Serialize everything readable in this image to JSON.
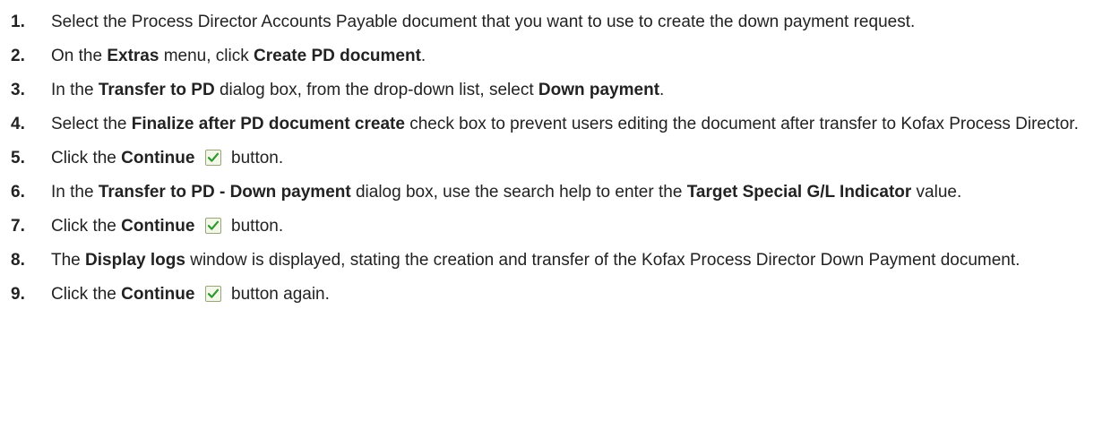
{
  "steps": [
    {
      "num": "1.",
      "segments": [
        {
          "text": "Select the Process Director Accounts Payable document that you want to use to create the down payment request.",
          "bold": false
        }
      ]
    },
    {
      "num": "2.",
      "segments": [
        {
          "text": "On the ",
          "bold": false
        },
        {
          "text": "Extras",
          "bold": true
        },
        {
          "text": " menu, click ",
          "bold": false
        },
        {
          "text": "Create PD document",
          "bold": true
        },
        {
          "text": ".",
          "bold": false
        }
      ]
    },
    {
      "num": "3.",
      "segments": [
        {
          "text": "In the ",
          "bold": false
        },
        {
          "text": "Transfer to PD",
          "bold": true
        },
        {
          "text": " dialog box, from the drop-down list, select ",
          "bold": false
        },
        {
          "text": "Down payment",
          "bold": true
        },
        {
          "text": ".",
          "bold": false
        }
      ]
    },
    {
      "num": "4.",
      "segments": [
        {
          "text": "Select the ",
          "bold": false
        },
        {
          "text": "Finalize after PD document create",
          "bold": true
        },
        {
          "text": " check box to prevent users editing the document after transfer to Kofax Process Director.",
          "bold": false
        }
      ]
    },
    {
      "num": "5.",
      "segments": [
        {
          "text": "Click the ",
          "bold": false
        },
        {
          "text": "Continue",
          "bold": true
        },
        {
          "icon": "checkmark-icon"
        },
        {
          "text": "button.",
          "bold": false
        }
      ]
    },
    {
      "num": "6.",
      "segments": [
        {
          "text": "In the ",
          "bold": false
        },
        {
          "text": "Transfer to PD - Down payment",
          "bold": true
        },
        {
          "text": " dialog box, use the search help to enter the ",
          "bold": false
        },
        {
          "text": "Target Special G/L Indicator",
          "bold": true
        },
        {
          "text": " value.",
          "bold": false
        }
      ]
    },
    {
      "num": "7.",
      "segments": [
        {
          "text": "Click the ",
          "bold": false
        },
        {
          "text": "Continue",
          "bold": true
        },
        {
          "icon": "checkmark-icon"
        },
        {
          "text": "button.",
          "bold": false
        }
      ]
    },
    {
      "num": "8.",
      "segments": [
        {
          "text": "The ",
          "bold": false
        },
        {
          "text": "Display logs",
          "bold": true
        },
        {
          "text": " window is displayed, stating the creation and transfer of the Kofax Process Director Down Payment document.",
          "bold": false
        }
      ]
    },
    {
      "num": "9.",
      "segments": [
        {
          "text": "Click the ",
          "bold": false
        },
        {
          "text": "Continue",
          "bold": true
        },
        {
          "icon": "checkmark-icon"
        },
        {
          "text": "button again.",
          "bold": false
        }
      ]
    }
  ],
  "colors": {
    "text": "#222222",
    "check_green": "#2e9a2e",
    "icon_bg": "#f3f7e8",
    "icon_border": "#9aa67a"
  }
}
